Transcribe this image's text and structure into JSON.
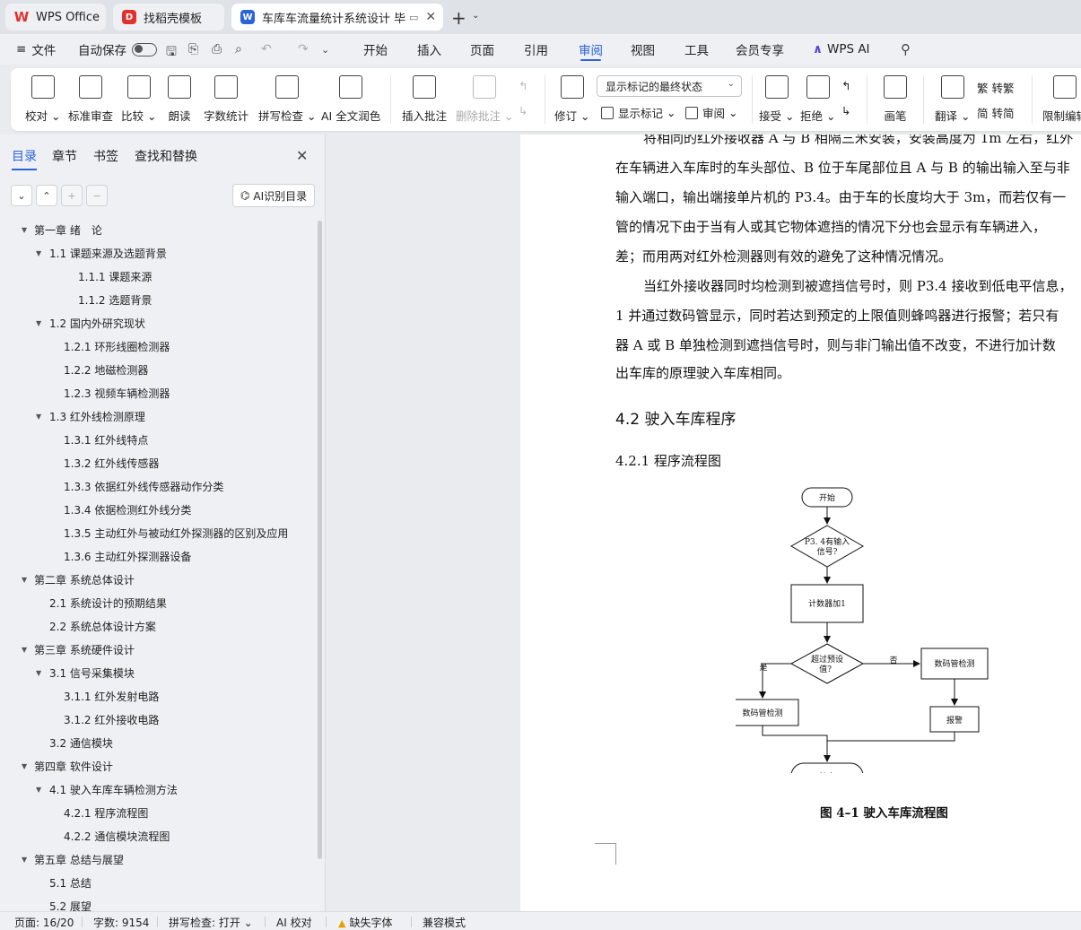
{
  "titlebar": {
    "tabs": [
      {
        "label": "WPS Office"
      },
      {
        "label": "找稻壳模板"
      },
      {
        "label": "车库车流量统计系统设计 毕业"
      }
    ]
  },
  "menubar": {
    "file": "文件",
    "autosave": "自动保存",
    "items": [
      "开始",
      "插入",
      "页面",
      "引用",
      "审阅",
      "视图",
      "工具",
      "会员专享",
      "WPS AI"
    ],
    "active": "审阅"
  },
  "ribbon": {
    "proofread": "校对",
    "std_review": "标准审查",
    "compare": "比较",
    "read_aloud": "朗读",
    "word_count": "字数统计",
    "spell_check": "拼写检查",
    "ai_polish": "AI 全文润色",
    "insert_comment": "插入批注",
    "delete_comment": "删除批注",
    "track_changes": "修订",
    "display_markup_dropdown": "显示标记的最终状态",
    "display_markup": "显示标记",
    "review_pane": "审阅",
    "accept": "接受",
    "reject": "拒绝",
    "pen": "画笔",
    "translate": "翻译",
    "to_traditional": "转繁",
    "to_simplified": "转简",
    "restrict_edit": "限制编辑"
  },
  "nav": {
    "tabs": [
      "目录",
      "章节",
      "书签",
      "查找和替换"
    ],
    "active_tab": "目录",
    "ai_toc_button": "AI识别目录",
    "toc": [
      {
        "label": "第一章 绪　论",
        "level": 1,
        "expanded": true
      },
      {
        "label": "1.1  课题来源及选题背景",
        "level": 2,
        "expanded": true
      },
      {
        "label": "1.1.1 课题来源",
        "level": 3,
        "indent": "deep"
      },
      {
        "label": "1.1.2  选题背景",
        "level": 3,
        "indent": "deep"
      },
      {
        "label": "1.2  国内外研究现状",
        "level": 2,
        "expanded": true
      },
      {
        "label": "1.2.1 环形线圈检测器",
        "level": 3
      },
      {
        "label": "1.2.2 地磁检测器",
        "level": 3
      },
      {
        "label": "1.2.3 视频车辆检测器",
        "level": 3
      },
      {
        "label": "1.3 红外线检测原理",
        "level": 2,
        "expanded": true
      },
      {
        "label": "1.3.1 红外线特点",
        "level": 3
      },
      {
        "label": "1.3.2 红外线传感器",
        "level": 3
      },
      {
        "label": "1.3.3 依据红外线传感器动作分类",
        "level": 3
      },
      {
        "label": "1.3.4 依据检测红外线分类",
        "level": 3
      },
      {
        "label": "1.3.5 主动红外与被动红外探测器的区别及应用",
        "level": 3
      },
      {
        "label": "1.3.6 主动红外探测器设备",
        "level": 3
      },
      {
        "label": "第二章  系统总体设计",
        "level": 1,
        "expanded": true
      },
      {
        "label": "2.1 系统设计的预期结果",
        "level": 2
      },
      {
        "label": "2.2 系统总体设计方案",
        "level": 2
      },
      {
        "label": "第三章  系统硬件设计",
        "level": 1,
        "expanded": true
      },
      {
        "label": "3.1 信号采集模块",
        "level": 2,
        "expanded": true
      },
      {
        "label": "3.1.1 红外发射电路",
        "level": 3
      },
      {
        "label": "3.1.2  红外接收电路",
        "level": 3
      },
      {
        "label": "3.2 通信模块",
        "level": 2
      },
      {
        "label": "第四章  软件设计",
        "level": 1,
        "expanded": true
      },
      {
        "label": "4.1 驶入车库车辆检测方法",
        "level": 2,
        "expanded": true
      },
      {
        "label": "4.2.1 程序流程图",
        "level": 3
      },
      {
        "label": "4.2.2  通信模块流程图",
        "level": 3
      },
      {
        "label": "第五章  总结与展望",
        "level": 1,
        "expanded": true
      },
      {
        "label": "5.1  总结",
        "level": 2
      },
      {
        "label": "5.2  展望",
        "level": 2
      }
    ]
  },
  "document": {
    "lines": [
      "将相同的红外接收器 A 与 B 相隔三米安装，安装高度为 1m 左右，红外",
      "在车辆进入车库时的车头部位、B 位于车尾部位且 A 与 B 的输出输入至与非",
      "输入端口，输出端接单片机的 P3.4。由于车的长度均大于 3m，而若仅有一",
      "管的情况下由于当有人或其它物体遮挡的情况下分也会显示有车辆进入，",
      "差；而用两对红外检测器则有效的避免了这种情况情况。",
      "当红外接收器同时均检测到被遮挡信号时，则 P3.4 接收到低电平信息，",
      "1 并通过数码管显示，同时若达到预定的上限值则蜂鸣器进行报警；若只有",
      "器 A 或 B 单独检测到遮挡信号时，则与非门输出值不改变，不进行加计数",
      "出车库的原理驶入车库相同。"
    ],
    "heading_4_2": "4.2 驶入车库程序",
    "heading_4_2_1": "4.2.1 程序流程图",
    "flowchart": {
      "start": "开始",
      "decision1_line1": "P3. 4有输入",
      "decision1_line2": "信号?",
      "counter": "计数器加1",
      "decision2_line1": "超过预设",
      "decision2_line2": "值?",
      "yes": "是",
      "no": "否",
      "display_left": "数码管检测",
      "display_right": "数码管检测",
      "alarm": "报警",
      "end": "结束"
    },
    "caption": "图 4–1 驶入车库流程图"
  },
  "status": {
    "page": "页面: 16/20",
    "words": "字数: 9154",
    "spell": "拼写检查: 打开",
    "ai_proof": "AI 校对",
    "missing_font": "缺失字体",
    "compat": "兼容模式"
  },
  "colors": {
    "accent": "#2b63d9",
    "wps_red": "#e0312d"
  }
}
